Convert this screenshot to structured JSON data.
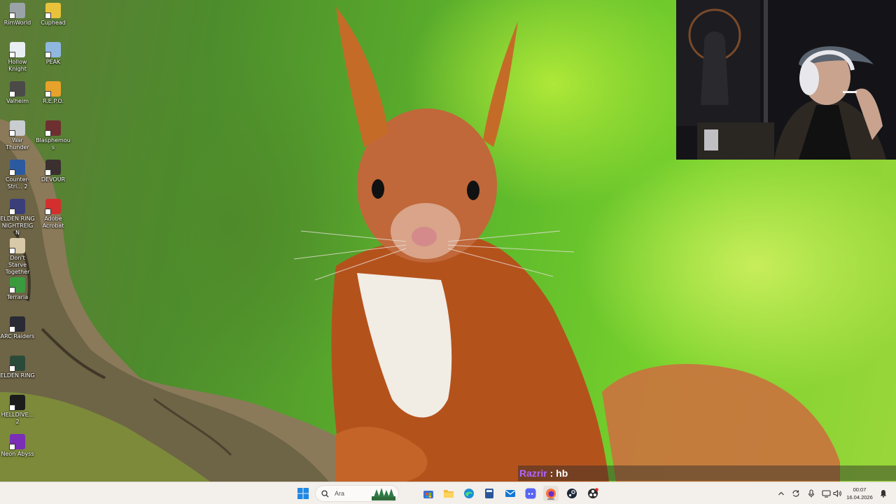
{
  "desktop": {
    "icons": [
      {
        "label": "RimWorld",
        "icon": "rimworld-icon"
      },
      {
        "label": "Cuphead",
        "icon": "cuphead-icon"
      },
      {
        "label": "Hollow Knight",
        "icon": "hollow-knight-icon"
      },
      {
        "label": "PEAK",
        "icon": "peak-icon"
      },
      {
        "label": "Valheim",
        "icon": "valheim-icon"
      },
      {
        "label": "R.E.P.O.",
        "icon": "repo-icon"
      },
      {
        "label": "War Thunder",
        "icon": "war-thunder-icon"
      },
      {
        "label": "Blasphemous",
        "icon": "blasphemous-icon"
      },
      {
        "label": "Counter-Stri... 2",
        "icon": "counter-strike-icon"
      },
      {
        "label": "DEVOUR",
        "icon": "devour-icon"
      },
      {
        "label": "ELDEN RING NIGHTREIGN",
        "icon": "elden-ring-nightreign-icon"
      },
      {
        "label": "Adobe Acrobat",
        "icon": "adobe-acrobat-icon"
      },
      {
        "label": "Don't Starve Together",
        "icon": "dont-starve-together-icon"
      },
      {
        "label": "Terraria",
        "icon": "terraria-icon"
      },
      {
        "label": "ARC Raiders",
        "icon": "arc-raiders-icon"
      },
      {
        "label": "ELDEN RING",
        "icon": "elden-ring-icon"
      },
      {
        "label": "HELLDIVE... 2",
        "icon": "helldivers-icon"
      },
      {
        "label": "Neon Abyss",
        "icon": "neon-abyss-icon"
      }
    ]
  },
  "chat": {
    "username": "Razrir",
    "separator": " : ",
    "message": "hb"
  },
  "taskbar": {
    "search_placeholder": "Ara",
    "pinned": [
      {
        "name": "start-button",
        "icon": "windows-logo-icon"
      },
      {
        "name": "widgets-button",
        "icon": "forest-widget-icon"
      },
      {
        "name": "ms-store-button",
        "icon": "store-icon"
      },
      {
        "name": "file-explorer-button",
        "icon": "folder-icon"
      },
      {
        "name": "edge-button",
        "icon": "edge-icon"
      },
      {
        "name": "calculator-button",
        "icon": "app-icon"
      },
      {
        "name": "outlook-button",
        "icon": "mail-icon"
      },
      {
        "name": "discord-button",
        "icon": "discord-icon"
      },
      {
        "name": "firefox-button",
        "icon": "firefox-icon"
      },
      {
        "name": "steam-button",
        "icon": "steam-icon"
      },
      {
        "name": "obs-button",
        "icon": "obs-icon"
      }
    ],
    "tray": {
      "overflow_icon": "chevron-up-icon",
      "time": "00:07",
      "date": "16.04.2026"
    }
  },
  "colors": {
    "wallpaper_green": "#6cc52e",
    "taskbar_bg": "#f3efea",
    "chat_username": "#b064ff",
    "windows_blue": "#1e88e5"
  }
}
